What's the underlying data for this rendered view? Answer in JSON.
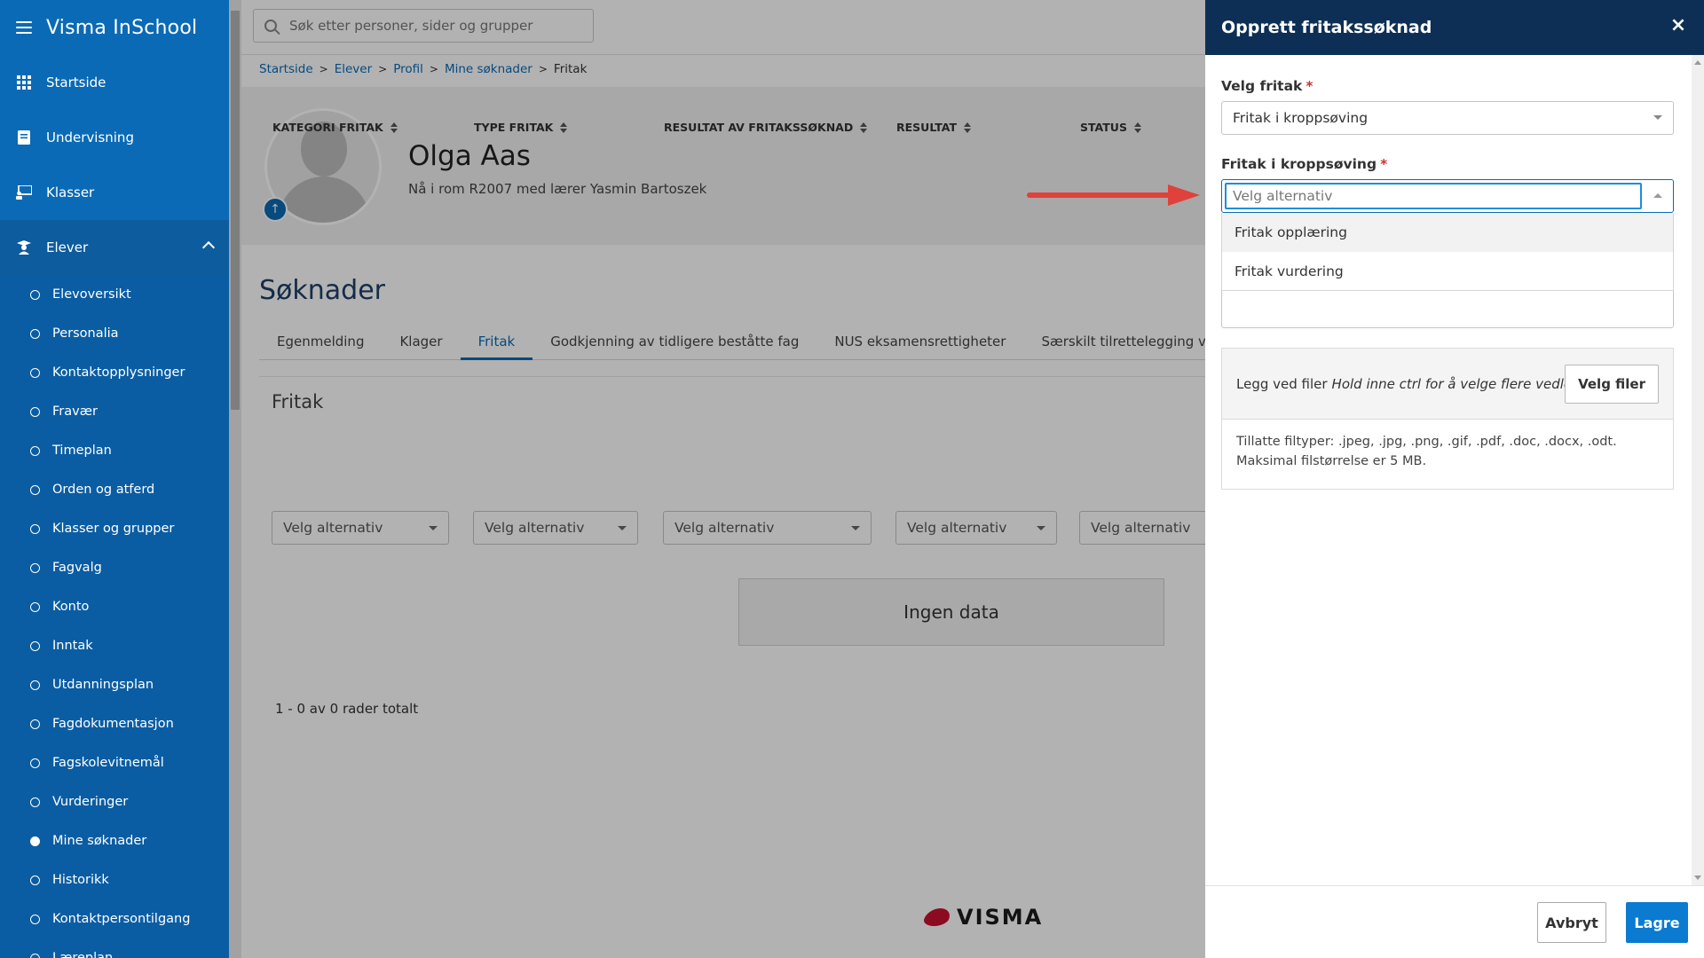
{
  "app": {
    "title": "Visma InSchool"
  },
  "sidebar": {
    "main_items": [
      {
        "label": "Startside",
        "icon": "grid-icon"
      },
      {
        "label": "Undervisning",
        "icon": "book-icon"
      },
      {
        "label": "Klasser",
        "icon": "chalkboard-icon"
      },
      {
        "label": "Elever",
        "icon": "student-icon"
      }
    ],
    "sub_items": [
      {
        "label": "Elevoversikt"
      },
      {
        "label": "Personalia"
      },
      {
        "label": "Kontaktopplysninger"
      },
      {
        "label": "Fravær"
      },
      {
        "label": "Timeplan"
      },
      {
        "label": "Orden og atferd"
      },
      {
        "label": "Klasser og grupper"
      },
      {
        "label": "Fagvalg"
      },
      {
        "label": "Konto"
      },
      {
        "label": "Inntak"
      },
      {
        "label": "Utdanningsplan"
      },
      {
        "label": "Fagdokumentasjon"
      },
      {
        "label": "Fagskolevitnemål"
      },
      {
        "label": "Vurderinger"
      },
      {
        "label": "Mine søknader"
      },
      {
        "label": "Historikk"
      },
      {
        "label": "Kontaktpersontilgang"
      },
      {
        "label": "Læreplan"
      }
    ]
  },
  "search": {
    "placeholder": "Søk etter personer, sider og grupper"
  },
  "breadcrumb": [
    "Startside",
    "Elever",
    "Profil",
    "Mine søknader",
    "Fritak"
  ],
  "profile": {
    "name": "Olga Aas",
    "room_info": "Nå i rom R2007 med lærer Yasmin Bartoszek"
  },
  "page": {
    "title": "Søknader",
    "tabs": [
      {
        "label": "Egenmelding"
      },
      {
        "label": "Klager"
      },
      {
        "label": "Fritak"
      },
      {
        "label": "Godkjenning av tidligere beståtte fag"
      },
      {
        "label": "NUS eksamensrettigheter"
      },
      {
        "label": "Særskilt tilrettelegging ved e"
      }
    ],
    "panel_title": "Fritak",
    "columns": [
      {
        "label": "KATEGORI FRITAK"
      },
      {
        "label": "TYPE FRITAK"
      },
      {
        "label": "RESULTAT AV FRITAKSSØKNAD"
      },
      {
        "label": "RESULTAT"
      },
      {
        "label": "STATUS"
      }
    ],
    "filter_placeholder": "Velg alternativ",
    "no_data": "Ingen data",
    "row_count": "1 - 0 av 0 rader totalt",
    "footer_logo": "VISMA"
  },
  "drawer": {
    "title": "Opprett fritakssøknad",
    "close": "×",
    "velg_fritak_label": "Velg fritak",
    "velg_fritak_value": "Fritak i kroppsøving",
    "fritak_label": "Fritak i kroppsøving",
    "required_mark": "*",
    "fritak_placeholder": "Velg alternativ",
    "options": [
      "Fritak opplæring",
      "Fritak vurdering"
    ],
    "attach_label": "Legg ved filer",
    "attach_hint": "Hold inne ctrl for å velge flere vedlegg",
    "choose_files": "Velg filer",
    "allowed_types": "Tillatte filtyper: .jpeg, .jpg, .png, .gif, .pdf, .doc, .docx, .odt.",
    "max_size": "Maksimal filstørrelse er 5 MB.",
    "cancel": "Avbryt",
    "save": "Lagre"
  },
  "colors": {
    "sidebar": "#0a6ab5",
    "drawer_header": "#0e2f55",
    "primary_button": "#0a7bd0",
    "annotation_arrow": "#e0413a"
  }
}
